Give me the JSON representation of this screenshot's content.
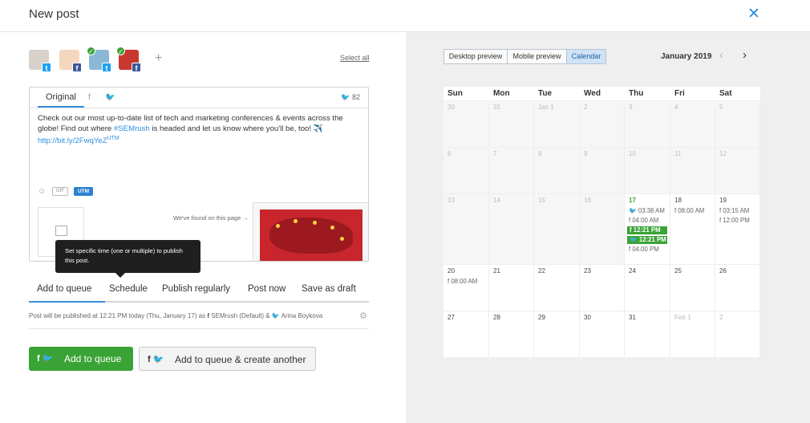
{
  "header": {
    "title": "New post",
    "close_icon": "close-icon"
  },
  "accounts": {
    "list": [
      {
        "name": "account-1",
        "network": "twitter",
        "selected": false
      },
      {
        "name": "account-2",
        "network": "facebook",
        "selected": false
      },
      {
        "name": "account-3",
        "network": "twitter",
        "selected": true
      },
      {
        "name": "account-4",
        "network": "facebook",
        "selected": true
      }
    ],
    "add_label": "+",
    "select_all": "Select all"
  },
  "editor": {
    "tabs": {
      "original": "Original",
      "facebook": "f",
      "twitter": "🐦"
    },
    "char_count": "82",
    "text_before": "Check out our most up-to-date list of tech and marketing conferences & events across the globe! Find out where ",
    "hashtag": "#SEMrush",
    "text_after": " is headed and let us know where you'll be, too! ✈️",
    "link": "http://bit.ly/2FwqYeZ",
    "link_sup": "UTM",
    "gif_label": "GIF",
    "utm_label": "UTM",
    "found_label": "We've found on this page →"
  },
  "tooltip": {
    "text": "Set specific time (one or multiple) to publish this post."
  },
  "post_tabs": {
    "add_to_queue": "Add to queue",
    "schedule": "Schedule",
    "publish_regularly": "Publish regularly",
    "post_now": "Post now",
    "save_as_draft": "Save as draft"
  },
  "info": {
    "prefix": "Post will be published at 12:21 PM today (Thu, January 17) as ",
    "fb_icon": "f",
    "fb_account": " SEMrush (Default) & ",
    "tw_icon": "🐦",
    "tw_account": " Arina Boykova"
  },
  "buttons": {
    "primary_icons": "f 🐦",
    "primary_label": "Add to queue",
    "secondary_icons": "f 🐦",
    "secondary_label": "Add to queue & create another"
  },
  "preview_tabs": {
    "desktop": "Desktop preview",
    "mobile": "Mobile preview",
    "calendar": "Calendar"
  },
  "calendar": {
    "month": "January 2019",
    "days": [
      "Sun",
      "Mon",
      "Tue",
      "Wed",
      "Thu",
      "Fri",
      "Sat"
    ],
    "week1": [
      "30",
      "31",
      "Jan 1",
      "2",
      "3",
      "4",
      "5"
    ],
    "week2": [
      "6",
      "7",
      "8",
      "9",
      "10",
      "11",
      "12"
    ],
    "week3": [
      "13",
      "14",
      "15",
      "16",
      "17",
      "18",
      "19"
    ],
    "week4": [
      "20",
      "21",
      "22",
      "23",
      "24",
      "25",
      "26"
    ],
    "week5": [
      "27",
      "28",
      "29",
      "30",
      "31",
      "Feb 1",
      "2"
    ],
    "events": {
      "thu17": [
        "03:38 AM",
        "04:00 AM",
        "12:21 PM",
        "12:21 PM",
        "04:00 PM"
      ],
      "fri18": [
        "08:00 AM"
      ],
      "sat19": [
        "03:15 AM",
        "12:00 PM"
      ],
      "sun20": [
        "08:00 AM"
      ]
    }
  },
  "colors": {
    "accent": "#3a8ed8",
    "green": "#3aa335",
    "twitter": "#1da1f2",
    "facebook": "#3b5998"
  }
}
